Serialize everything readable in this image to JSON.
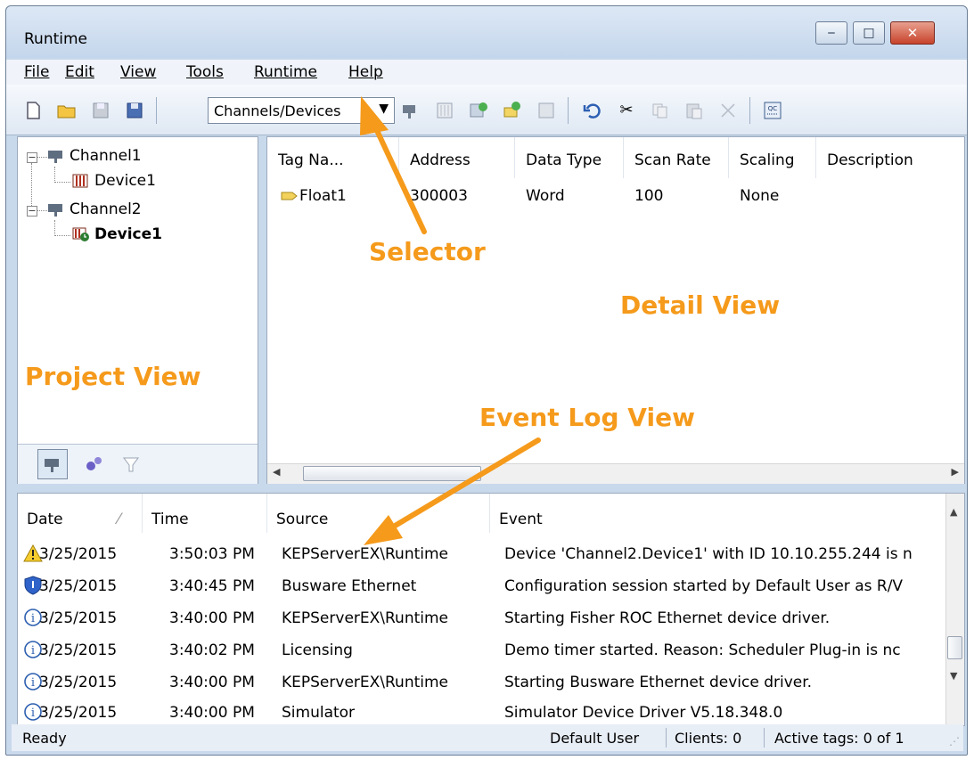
{
  "window": {
    "title": "Runtime",
    "minimize": "‒",
    "maximize": "□",
    "close": "✕"
  },
  "menu": [
    "File",
    "Edit",
    "View",
    "Tools",
    "Runtime",
    "Help"
  ],
  "toolbar": {
    "selector_value": "Channels/Devices"
  },
  "project_tree": [
    {
      "label": "Channel1",
      "icon": "channel-icon"
    },
    {
      "label": "Device1",
      "icon": "device-icon"
    },
    {
      "label": "Channel2",
      "icon": "channel-icon"
    },
    {
      "label": "Device1",
      "icon": "device-clock-icon",
      "bold": true
    }
  ],
  "detail": {
    "columns": [
      "Tag Na...",
      "Address",
      "Data Type",
      "Scan Rate",
      "Scaling",
      "Description"
    ],
    "rows": [
      {
        "tag": "Float1",
        "address": "300003",
        "data_type": "Word",
        "scan_rate": "100",
        "scaling": "None",
        "description": ""
      }
    ]
  },
  "event_log": {
    "columns": [
      "Date",
      "Time",
      "Source",
      "Event"
    ],
    "rows": [
      {
        "icon": "warning-icon",
        "date": "3/25/2015",
        "time": "3:50:03 PM",
        "source": "KEPServerEX\\Runtime",
        "event": "Device 'Channel2.Device1' with ID 10.10.255.244 is n"
      },
      {
        "icon": "shield-icon",
        "date": "3/25/2015",
        "time": "3:40:45 PM",
        "source": "Busware Ethernet",
        "event": "Configuration session started by Default User as R/V"
      },
      {
        "icon": "info-icon",
        "date": "3/25/2015",
        "time": "3:40:00 PM",
        "source": "KEPServerEX\\Runtime",
        "event": "Starting Fisher ROC Ethernet device driver."
      },
      {
        "icon": "info-icon",
        "date": "3/25/2015",
        "time": "3:40:02 PM",
        "source": "Licensing",
        "event": "Demo timer started. Reason: Scheduler Plug-in is nc"
      },
      {
        "icon": "info-icon",
        "date": "3/25/2015",
        "time": "3:40:00 PM",
        "source": "KEPServerEX\\Runtime",
        "event": "Starting Busware Ethernet device driver."
      },
      {
        "icon": "info-icon",
        "date": "3/25/2015",
        "time": "3:40:00 PM",
        "source": "Simulator",
        "event": "Simulator Device Driver V5.18.348.0"
      }
    ]
  },
  "status": {
    "ready": "Ready",
    "user": "Default User",
    "clients": "Clients:  0",
    "active_tags": "Active tags:  0 of 1"
  },
  "annotations": {
    "selector": "Selector",
    "detail_view": "Detail View",
    "project_view": "Project View",
    "event_log_view": "Event Log View",
    "color": "#f59a1b"
  }
}
